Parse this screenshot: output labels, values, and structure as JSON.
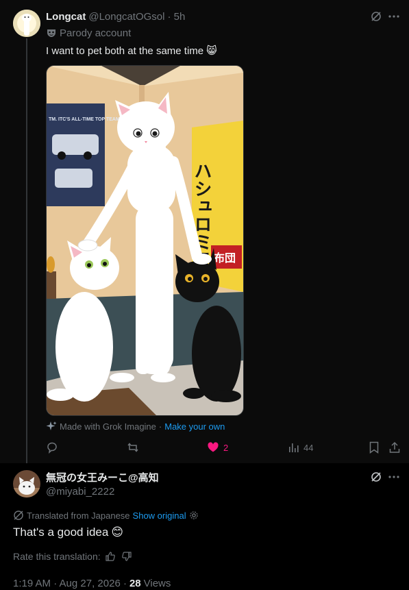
{
  "tweet": {
    "display_name": "Longcat",
    "handle": "@LongcatOGsol",
    "time": "· 5h",
    "parody_label": "Parody account",
    "text": "I want to pet both at the same time",
    "text_emoji": "😸",
    "media_credit": "Made with Grok Imagine",
    "media_sep": "·",
    "media_link": "Make your own",
    "image_texts": {
      "poster_title": "TM. ITC'S ALL-TIME TOP TEAM",
      "banner_text": "ハシュロミラ",
      "banner_sub": "布団"
    },
    "actions": {
      "replies": "",
      "reposts": "",
      "likes": "2",
      "views": "44"
    },
    "colors": {
      "like": "#f91880",
      "link": "#1d9bf0"
    }
  },
  "reply": {
    "display_name": "無冠の女王みーこ@高知",
    "handle": "@miyabi_2222",
    "translated_label": "Translated from Japanese",
    "show_original": "Show original",
    "text": "That's a good idea",
    "text_emoji": "😊",
    "rate_label": "Rate this translation:",
    "timestamp": "1:19 AM · Aug 27, 2026 ·",
    "views_count": "28",
    "views_label": "Views"
  }
}
